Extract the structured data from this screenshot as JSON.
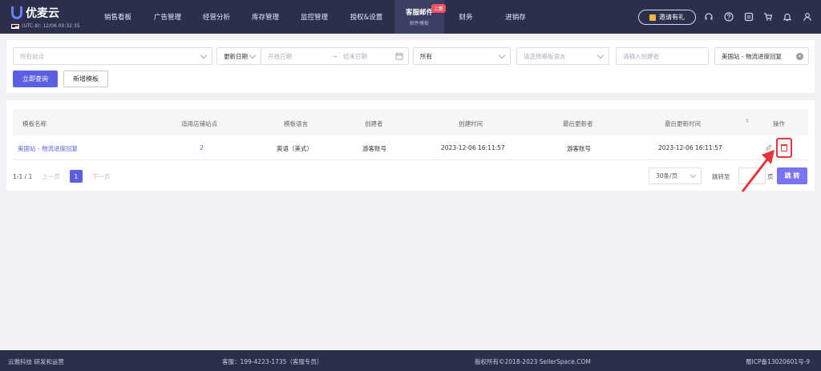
{
  "nav": {
    "logo": "优麦云",
    "timezone": "(UTC-8): 12/06 00:32:35",
    "items": [
      {
        "label": "销售看板"
      },
      {
        "label": "广告管理"
      },
      {
        "label": "经营分析"
      },
      {
        "label": "库存管理"
      },
      {
        "label": "监控管理"
      },
      {
        "label": "授权&设置"
      },
      {
        "label": "客服邮件",
        "sub": "邮件模板",
        "badge": "上新"
      },
      {
        "label": "财务"
      },
      {
        "label": "进销存"
      }
    ],
    "invite": "邀请有礼"
  },
  "filters": {
    "site_placeholder": "所有站点",
    "date_type": "更新日期",
    "start_placeholder": "开始日期",
    "range_sep": "→",
    "end_placeholder": "结束日期",
    "status": "所有",
    "language_placeholder": "请选择模板语言",
    "creator_placeholder": "请输入创建者",
    "template_value": "美国站 - 物流进度回复",
    "query_button": "立即查询",
    "add_button": "新增模板"
  },
  "table": {
    "columns": [
      "模板名称",
      "适用店铺站点",
      "模板语言",
      "创建者",
      "创建时间",
      "最后更新者",
      "最后更新时间",
      "操作"
    ],
    "rows": [
      {
        "name": "美国站 - 物流进度回复",
        "sites": "2",
        "language": "英语（美式）",
        "creator": "游客账号",
        "created": "2023-12-06 16:11:57",
        "updater": "游客账号",
        "updated": "2023-12-06 16:11:57"
      }
    ]
  },
  "pager": {
    "range": "1-1 / 1",
    "prev": "上一页",
    "page": "1",
    "next": "下一页",
    "size": "30条/页",
    "jump_label": "跳转至",
    "jump_suffix": "页",
    "jump_button": "跳 转"
  },
  "footer": {
    "company": "云雅科技 研发和运营",
    "support": "客服：199-4223-1735（客服专员）",
    "copyright": "版权所有©2018-2023 SellerSpace.COM",
    "icp": "蜀ICP备13020601号-9"
  },
  "colors": {
    "nav_bg": "#2b2f4b",
    "primary": "#5b5fe2",
    "danger": "#e8343a"
  }
}
